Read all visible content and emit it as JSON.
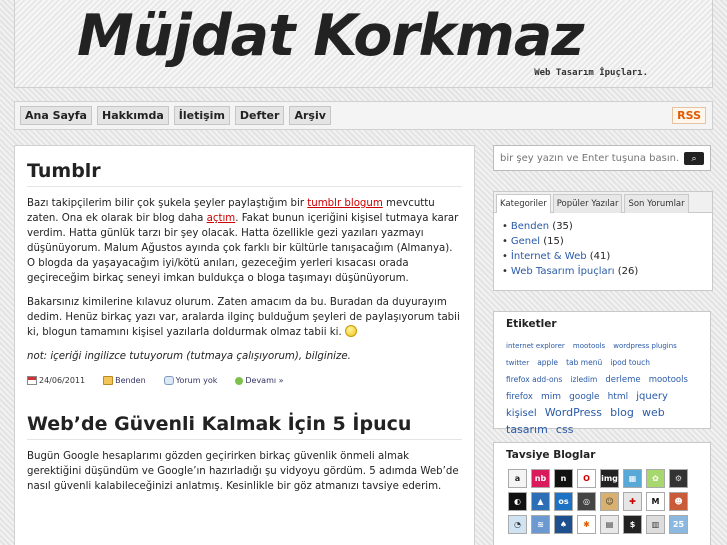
{
  "header": {
    "site_title": "Müjdat Korkmaz",
    "tagline": "Web Tasarım İpuçları."
  },
  "nav": {
    "items": [
      "Ana Sayfa",
      "Hakkımda",
      "İletişim",
      "Defter",
      "Arşiv"
    ],
    "rss_label": "RSS"
  },
  "posts": [
    {
      "title": "Tumblr",
      "p1": {
        "t1": "Bazı takipçilerim bilir çok şukela şeyler paylaştığım bir ",
        "link1": "tumblr blogum",
        "t2": " mevcuttu zaten. Ona ek olarak bir blog daha ",
        "link2": "açtım",
        "t3": ". Fakat bunun içeriğini kişisel tutmaya karar verdim. Hatta günlük tarzı bir şey olacak. Hatta özellikle gezi yazıları yazmayı düşünüyorum. Malum Ağustos ayında çok farklı bir kültürle tanışacağım (Almanya). O blogda da yaşayacağım iyi/kötü anıları, gezeceğim yerleri kısacası orada geçireceğim birkaç seneyi imkan buldukça o bloga taşımayı düşünüyorum."
      },
      "p2": "Bakarsınız kimilerine kılavuz olurum. Zaten amacım da bu. Buradan da duyurayım dedim. Henüz birkaç yazı var, aralarda ilginç bulduğum şeyleri de paylaşıyorum tabii ki, blogun tamamını kişisel yazılarla doldurmak olmaz tabii ki.",
      "note": "not: içeriği ingilizce tutuyorum (tutmaya çalışıyorum), bilginize.",
      "meta": {
        "date": "24/06/2011",
        "category": "Benden",
        "comments": "Yorum yok",
        "more": "Devamı »"
      }
    },
    {
      "title": "Web’de Güvenli Kalmak İçin 5 İpucu",
      "p1": "Bugün Google hesaplarımı gözden geçirirken birkaç güvenlik önmeli almak gerektiğini düşündüm ve Google’ın hazırladığı şu vidyoyu gördüm. 5 adımda Web’de nasıl güvenli kalabileceğinizi anlatmış. Kesinlikle bir göz atmanızı tavsiye ederim."
    }
  ],
  "sidebar": {
    "search_placeholder": "bir şey yazın ve Enter tuşuna basın...",
    "tabs": [
      "Kategoriler",
      "Popüler Yazılar",
      "Son Yorumlar"
    ],
    "categories": [
      {
        "name": "Benden",
        "count": "(35)"
      },
      {
        "name": "Genel",
        "count": "(15)"
      },
      {
        "name": "İnternet & Web",
        "count": "(41)"
      },
      {
        "name": "Web Tasarım İpuçları",
        "count": "(26)"
      }
    ],
    "tags_title": "Etiketler",
    "tags": [
      {
        "t": "internet explorer",
        "s": 7
      },
      {
        "t": "mootools",
        "s": 7
      },
      {
        "t": "wordpress plugins",
        "s": 7
      },
      {
        "t": "twitter",
        "s": 7
      },
      {
        "t": "apple",
        "s": 7.5
      },
      {
        "t": "tab menü",
        "s": 7.5
      },
      {
        "t": "ipod touch",
        "s": 7.5
      },
      {
        "t": "firefox add-ons",
        "s": 7.5
      },
      {
        "t": "izledim",
        "s": 7.5
      },
      {
        "t": "derleme",
        "s": 8.5
      },
      {
        "t": "mootools",
        "s": 8.5
      },
      {
        "t": "firefox",
        "s": 8.5
      },
      {
        "t": "mim",
        "s": 9
      },
      {
        "t": "google",
        "s": 9
      },
      {
        "t": "html",
        "s": 9
      },
      {
        "t": "jquery",
        "s": 10
      },
      {
        "t": "kişisel",
        "s": 10
      },
      {
        "t": "WordPress",
        "s": 11
      },
      {
        "t": "blog",
        "s": 11
      },
      {
        "t": "web",
        "s": 11
      },
      {
        "t": "tasarım",
        "s": 11
      },
      {
        "t": "css",
        "s": 11
      }
    ],
    "blogs_title": "Tavsiye Bloglar",
    "blog_tiles": [
      {
        "label": "a",
        "bg": "#f4f4f4",
        "fg": "#222"
      },
      {
        "label": "nb",
        "bg": "#d91b5c",
        "fg": "#fff"
      },
      {
        "label": "n",
        "bg": "#111111",
        "fg": "#fff"
      },
      {
        "label": "O",
        "bg": "#ffffff",
        "fg": "#c00"
      },
      {
        "label": "img",
        "bg": "#222222",
        "fg": "#fff"
      },
      {
        "label": "▦",
        "bg": "#58a8d8",
        "fg": "#fff"
      },
      {
        "label": "✿",
        "bg": "#a6d86e",
        "fg": "#fff"
      },
      {
        "label": "⚙",
        "bg": "#333333",
        "fg": "#ddd"
      },
      {
        "label": "◐",
        "bg": "#111111",
        "fg": "#fff"
      },
      {
        "label": "▲",
        "bg": "#2c6fb6",
        "fg": "#fff"
      },
      {
        "label": "os",
        "bg": "#1d72c4",
        "fg": "#fff"
      },
      {
        "label": "◎",
        "bg": "#444444",
        "fg": "#fff"
      },
      {
        "label": "☺",
        "bg": "#d8b070",
        "fg": "#333"
      },
      {
        "label": "✚",
        "bg": "#e6e6e6",
        "fg": "#c00"
      },
      {
        "label": "M",
        "bg": "#ffffff",
        "fg": "#111"
      },
      {
        "label": "☻",
        "bg": "#c95a3a",
        "fg": "#fff"
      },
      {
        "label": "◔",
        "bg": "#cfe3f3",
        "fg": "#333"
      },
      {
        "label": "≋",
        "bg": "#6c9ad0",
        "fg": "#fff"
      },
      {
        "label": "♠",
        "bg": "#1e4f8f",
        "fg": "#fff"
      },
      {
        "label": "✱",
        "bg": "#ffffff",
        "fg": "#e05a00"
      },
      {
        "label": "▤",
        "bg": "#e8e8e8",
        "fg": "#333"
      },
      {
        "label": "$",
        "bg": "#222222",
        "fg": "#fff"
      },
      {
        "label": "▥",
        "bg": "#dddddd",
        "fg": "#333"
      },
      {
        "label": "25",
        "bg": "#8cb8e0",
        "fg": "#fff"
      }
    ]
  }
}
